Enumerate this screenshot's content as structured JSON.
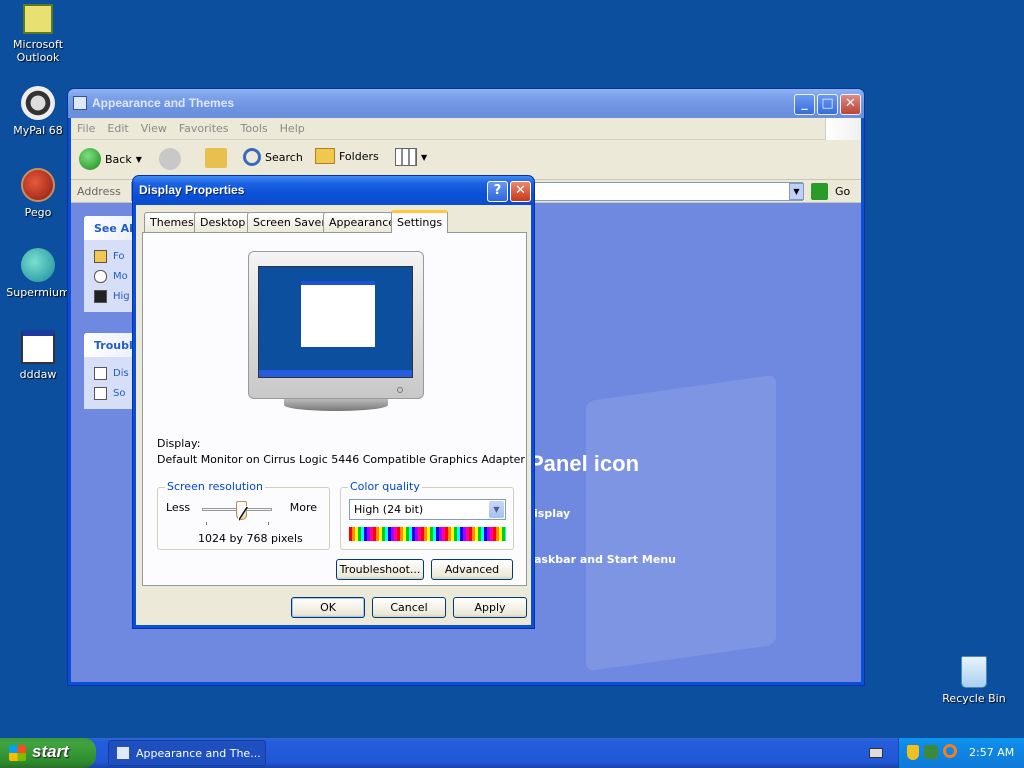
{
  "desktop": {
    "icons": [
      {
        "label": "Microsoft Outlook"
      },
      {
        "label": "MyPal 68"
      },
      {
        "label": "Pego"
      },
      {
        "label": "Supermium"
      },
      {
        "label": "dddaw"
      },
      {
        "label": "Recycle Bin"
      }
    ]
  },
  "explorer": {
    "title": "Appearance and Themes",
    "menu": [
      "File",
      "Edit",
      "View",
      "Favorites",
      "Tools",
      "Help"
    ],
    "toolbar": {
      "back": "Back",
      "search": "Search",
      "folders": "Folders"
    },
    "address_label": "Address",
    "go_label": "Go",
    "see_also": {
      "title": "See Al",
      "items": [
        "Fo",
        "Mo",
        "Hig"
      ]
    },
    "troubleshooters": {
      "title": "Troubl",
      "items": [
        "Dis",
        "So"
      ]
    },
    "main_heading": "Panel icon",
    "links": [
      "isplay",
      "askbar and Start Menu"
    ]
  },
  "dialog": {
    "title": "Display Properties",
    "tabs": [
      "Themes",
      "Desktop",
      "Screen Saver",
      "Appearance",
      "Settings"
    ],
    "active_tab": "Settings",
    "display_label": "Display:",
    "display_value": "Default Monitor on Cirrus Logic 5446 Compatible Graphics Adapter",
    "resolution": {
      "legend": "Screen resolution",
      "less": "Less",
      "more": "More",
      "value_text": "1024 by 768 pixels",
      "slider_position": 0.55
    },
    "color_quality": {
      "legend": "Color quality",
      "selected": "High (24 bit)"
    },
    "buttons": {
      "troubleshoot": "Troubleshoot...",
      "advanced": "Advanced",
      "ok": "OK",
      "cancel": "Cancel",
      "apply": "Apply"
    }
  },
  "taskbar": {
    "start_label": "start",
    "task_button": "Appearance and The...",
    "clock": "2:57 AM"
  },
  "colors": {
    "desktop": "#0c4f9f",
    "title_active": "#0a52d8",
    "accent_orange": "#ffc83c"
  }
}
